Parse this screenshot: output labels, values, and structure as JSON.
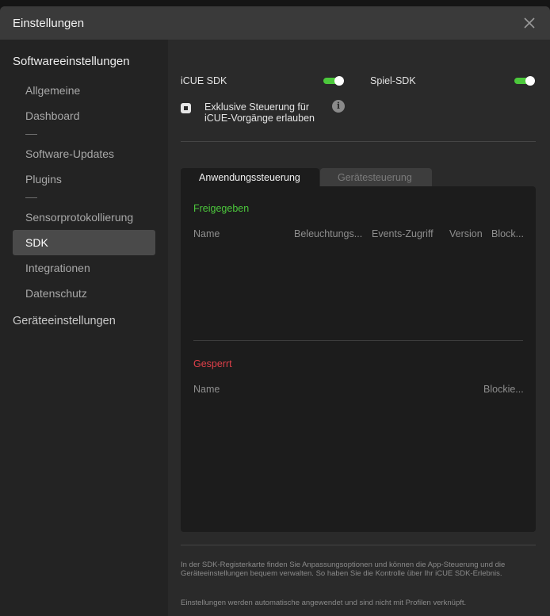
{
  "window": {
    "title": "Einstellungen"
  },
  "sidebar": {
    "software_header": "Softwareeinstellungen",
    "items": [
      {
        "label": "Allgemeine"
      },
      {
        "label": "Dashboard"
      },
      {
        "label": "Software-Updates"
      },
      {
        "label": "Plugins"
      },
      {
        "label": "Sensorprotokollierung"
      },
      {
        "label": "SDK"
      },
      {
        "label": "Integrationen"
      },
      {
        "label": "Datenschutz"
      }
    ],
    "active_item": "SDK",
    "device_header": "Geräteeinstellungen"
  },
  "main": {
    "icue_sdk": {
      "label": "iCUE SDK",
      "enabled": true
    },
    "game_sdk": {
      "label": "Spiel-SDK",
      "enabled": true
    },
    "exclusive": {
      "label": "Exklusive Steuerung für iCUE-Vorgänge erlauben",
      "checked": true
    },
    "tabs": [
      {
        "label": "Anwendungssteuerung",
        "active": true
      },
      {
        "label": "Gerätesteuerung",
        "active": false
      }
    ],
    "allowed": {
      "title": "Freigegeben",
      "columns": [
        "Name",
        "Beleuchtungs...",
        "Events-Zugriff",
        "Version",
        "Block..."
      ]
    },
    "blocked": {
      "title": "Gesperrt",
      "columns": [
        "Name",
        "Blockie..."
      ]
    },
    "footer": {
      "description": "In der SDK-Registerkarte finden Sie Anpassungsoptionen und können die App-Steuerung und die Geräteeinstellungen bequem verwalten. So haben Sie die Kontrolle über Ihr iCUE SDK-Erlebnis.",
      "note": "Einstellungen werden automatische angewendet und sind nicht mit Profilen verknüpft."
    }
  },
  "colors": {
    "accent_green": "#4cc83c",
    "blocked_red": "#e0404a",
    "active_item_bg": "#4a4a4a"
  },
  "icons": {
    "close": "close-icon",
    "info": "info-icon"
  }
}
